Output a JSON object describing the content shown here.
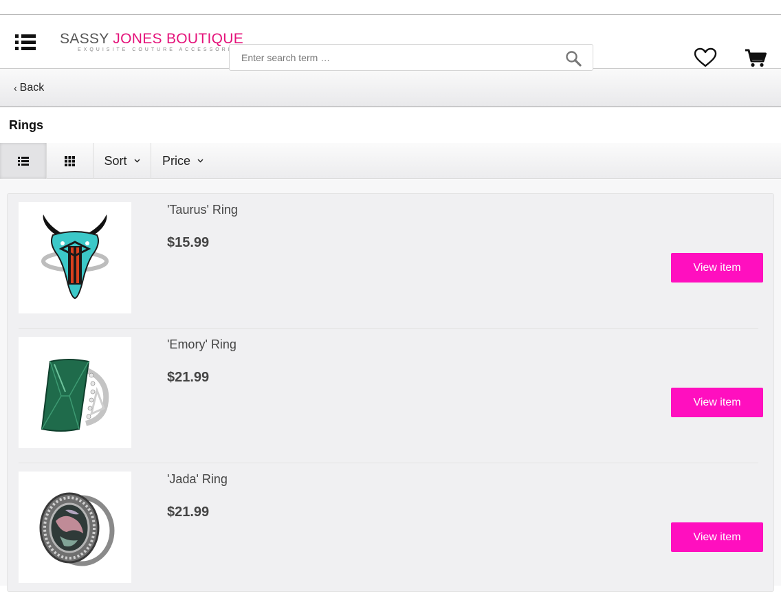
{
  "header": {
    "logo_main_a": "SASSY ",
    "logo_main_b": "JONES BOUTIQUE",
    "logo_tagline": "EXQUISITE COUTURE ACCESSORIES",
    "search_placeholder": "Enter search term …"
  },
  "nav": {
    "back_label": "Back"
  },
  "page": {
    "title": "Rings"
  },
  "toolbar": {
    "sort_label": "Sort",
    "price_label": "Price"
  },
  "products": [
    {
      "name": "'Taurus' Ring",
      "price": "$15.99",
      "button": "View item"
    },
    {
      "name": "'Emory' Ring",
      "price": "$21.99",
      "button": "View item"
    },
    {
      "name": "'Jada' Ring",
      "price": "$21.99",
      "button": "View item"
    }
  ],
  "colors": {
    "accent": "#ff0fbf",
    "brand_pink": "#e4127a"
  }
}
